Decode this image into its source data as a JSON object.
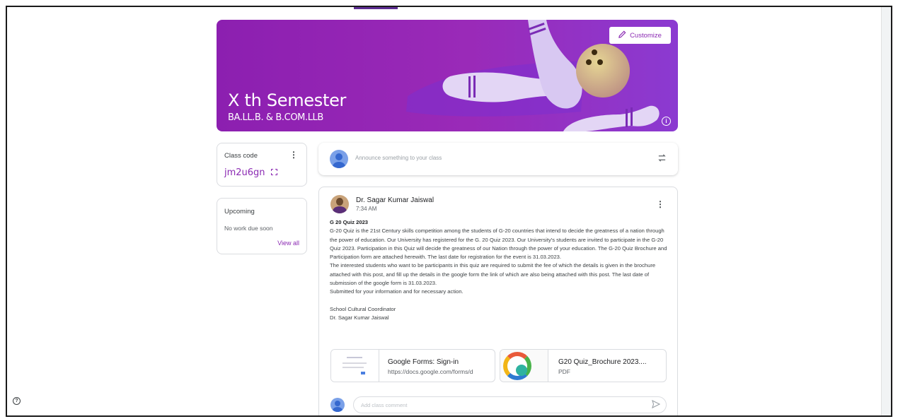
{
  "banner": {
    "title": "X th Semester",
    "subtitle": "BA.LL.B. & B.COM.LLB",
    "customize_label": "Customize"
  },
  "class_code": {
    "label": "Class code",
    "value": "jm2u6gn"
  },
  "upcoming": {
    "title": "Upcoming",
    "empty_text": "No work due soon",
    "view_all": "View all"
  },
  "announce": {
    "placeholder": "Announce something to your class"
  },
  "post": {
    "author": "Dr. Sagar Kumar Jaiswal",
    "time": "7:34 AM",
    "title": "G 20 Quiz 2023",
    "paragraph1": "G-20 Quiz is the 21st Century skills competition among the students of G-20 countries that intend to decide the greatness of a nation through the power of education. Our University has registered for the G. 20 Quiz 2023. Our University's students are invited to participate in the G-20 Quiz 2023. Participation in this Quiz will decide the greatness of our Nation through the power of your education. The G-20 Quiz Brochure and Participation form are attached herewith. The last date for registration for the event is 31.03.2023.",
    "paragraph2": " The interested students who want to be participants in this quiz are required to submit the fee of which the details is given in the brochure attached with this post, and fill up the details in the google form the link of which are also being attached with this post. The last date of submission of the google form is 31.03.2023.",
    "paragraph3": "Submitted for your information and for necessary action.",
    "signature_line1": "School Cultural Coordinator",
    "signature_line2": "Dr. Sagar Kumar Jaiswal",
    "attachments": [
      {
        "title": "Google Forms: Sign-in",
        "subtitle": "https://docs.google.com/forms/d"
      },
      {
        "title": "G20 Quiz_Brochure 2023....",
        "subtitle": "PDF"
      }
    ],
    "comment_placeholder": "Add class comment"
  },
  "colors": {
    "accent": "#8b2ab3",
    "banner_start": "#8c1fb0",
    "banner_end": "#8b3ad1"
  }
}
